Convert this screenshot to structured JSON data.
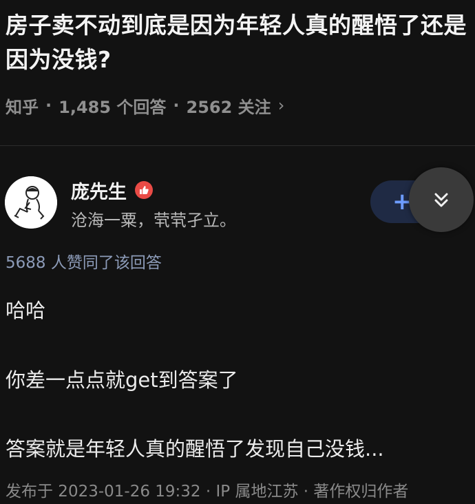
{
  "question": {
    "title": "房子卖不动到底是因为年轻人真的醒悟了还是因为没钱?",
    "source": "知乎",
    "answers_count": "1,485 个回答",
    "followers_count": "2562 关注",
    "separator": "·",
    "more_icon": "chevron-right-icon"
  },
  "author": {
    "name": "庞先生",
    "bio": "沧海一粟，茕茕孑立。",
    "avatar_icon": "sketch-avatar",
    "badge_icon": "thumbs-up-badge-icon",
    "badge_color": "#e94b46"
  },
  "actions": {
    "follow_label": "+",
    "collapse_icon": "double-chevron-down-icon",
    "accent": "#6d9cff"
  },
  "answer": {
    "vote_summary": "5688 人赞同了该回答",
    "paragraphs": [
      "哈哈",
      "你差一点点就get到答案了",
      "答案就是年轻人真的醒悟了发现自己没钱..."
    ],
    "footer": "发布于 2023-01-26 19:32 · IP 属地江苏 · 著作权归作者"
  }
}
